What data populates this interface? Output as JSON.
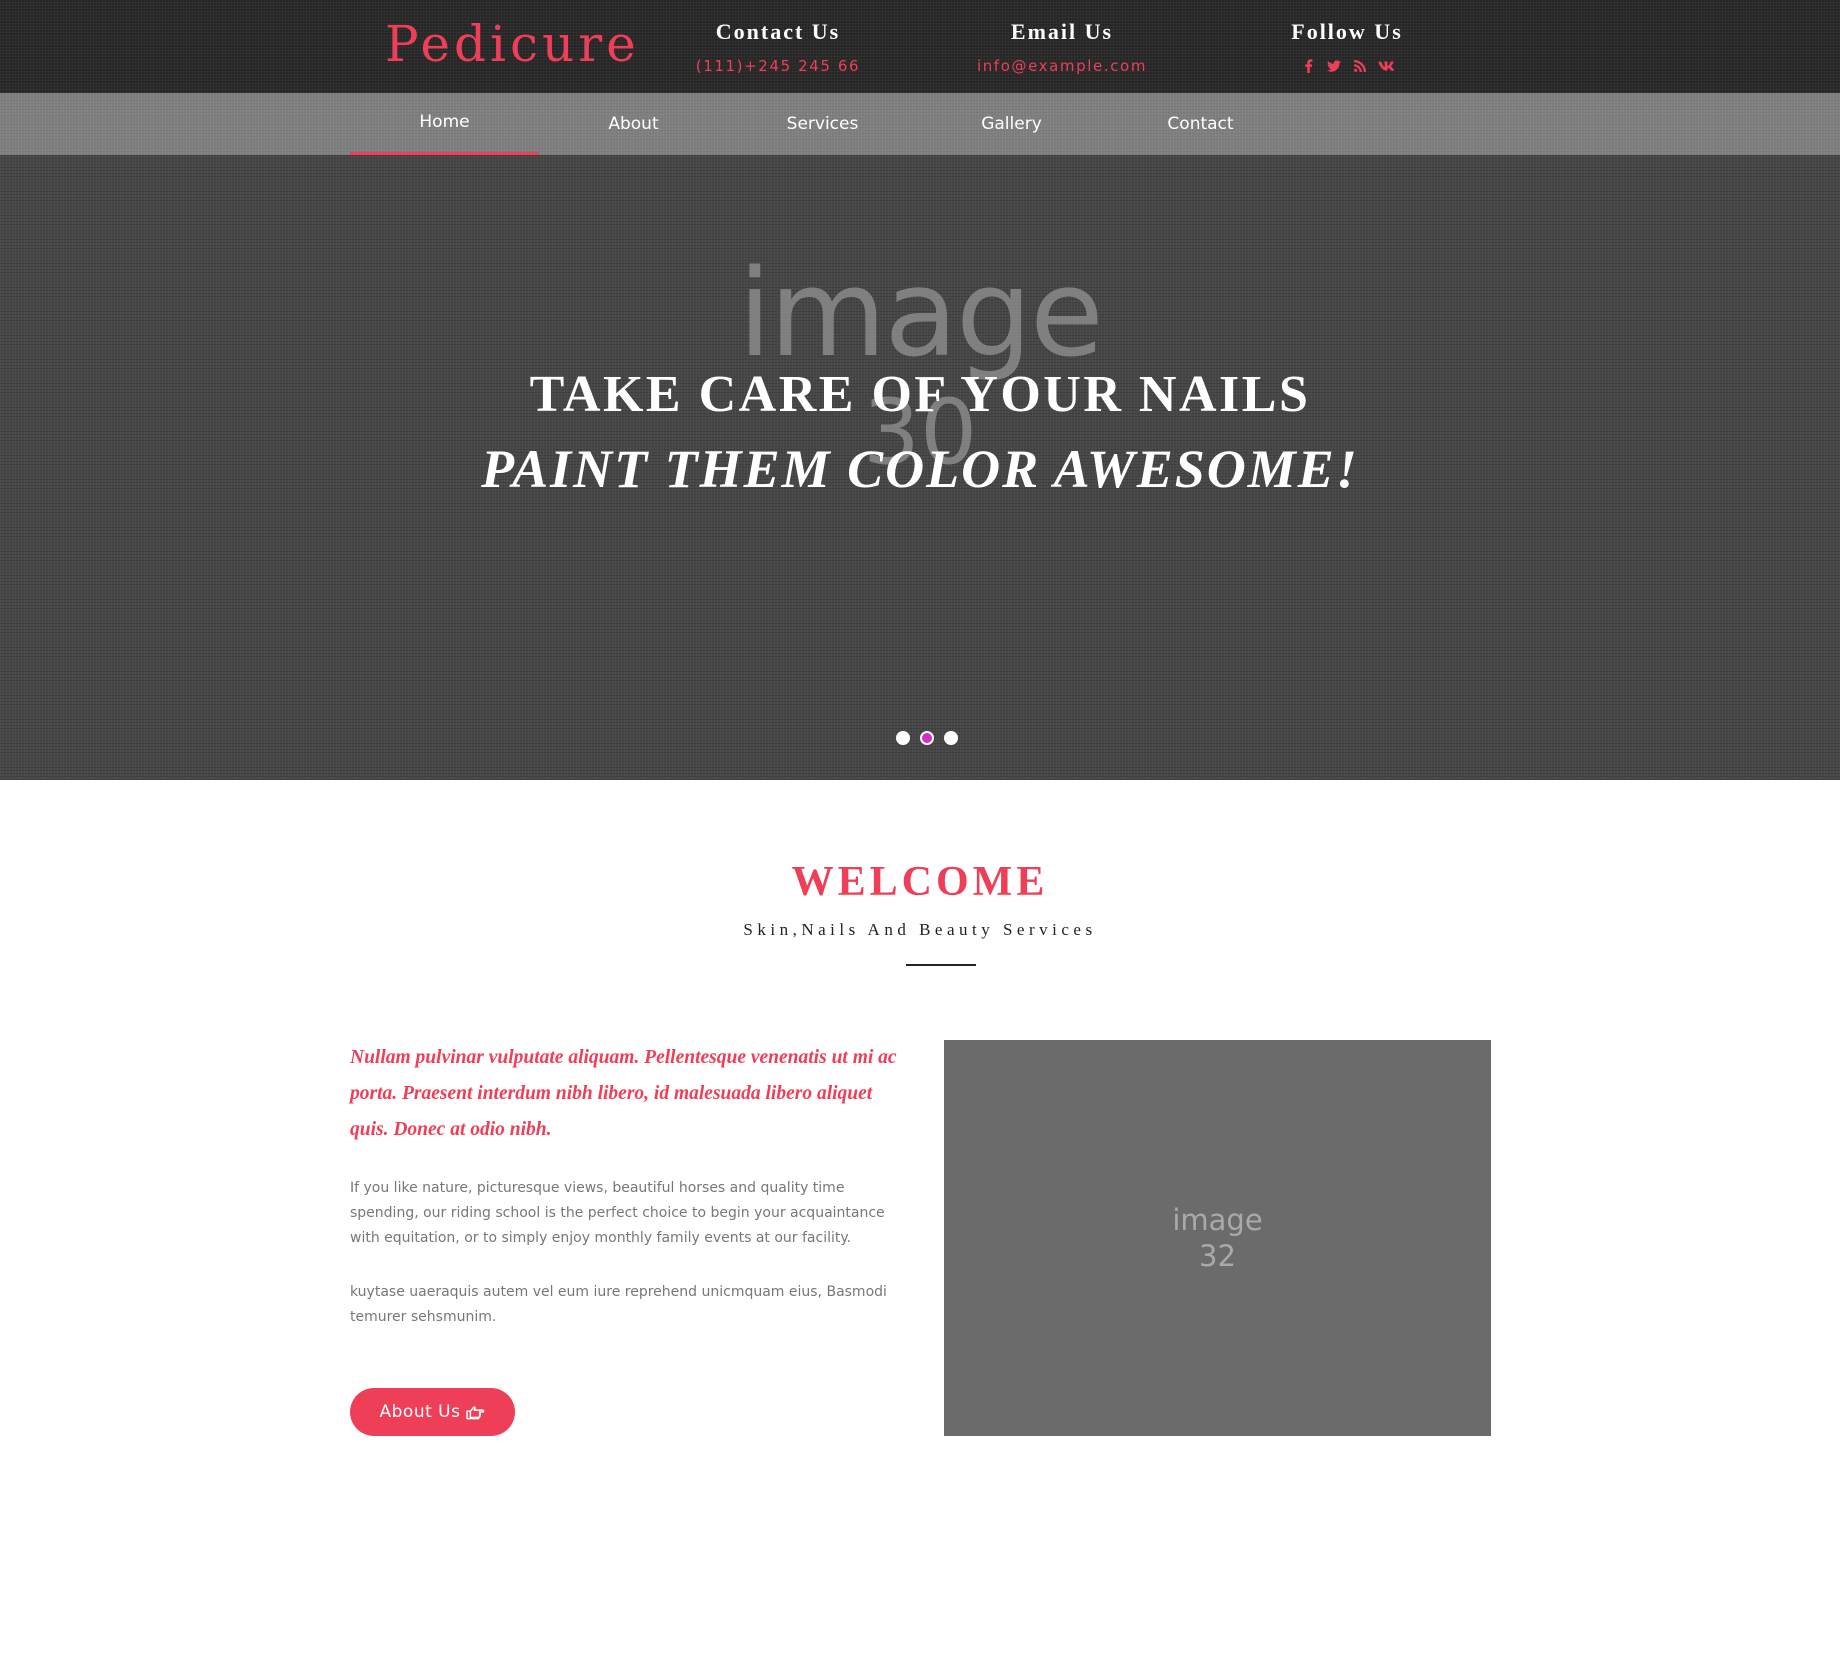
{
  "header": {
    "logo": "Pedicure",
    "contact": {
      "title": "Contact Us",
      "value": "(111)+245 245 66"
    },
    "email": {
      "title": "Email Us",
      "value": "info@example.com"
    },
    "follow": {
      "title": "Follow Us",
      "icons": [
        "facebook-icon",
        "twitter-icon",
        "rss-icon",
        "vk-icon"
      ]
    }
  },
  "nav": {
    "items": [
      {
        "label": "Home",
        "active": true
      },
      {
        "label": "About"
      },
      {
        "label": "Services"
      },
      {
        "label": "Gallery"
      },
      {
        "label": "Contact"
      }
    ]
  },
  "hero": {
    "placeholder_word": "image",
    "placeholder_number": "30",
    "line1": "TAKE CARE OF YOUR NAILS",
    "line2": "PAINT THEM COLOR AWESOME!",
    "slides": 3,
    "active_slide": 2
  },
  "welcome": {
    "title": "WELCOME",
    "subtitle": "Skin,Nails And Beauty Services",
    "lead": "Nullam pulvinar vulputate aliquam. Pellentesque venenatis ut mi ac porta. Praesent interdum nibh libero, id malesuada libero aliquet quis. Donec at odio nibh.",
    "paragraph1": "If you like nature, picturesque views, beautiful horses and quality time spending, our riding school is the perfect choice to begin your acquaintance with equitation, or to simply enjoy monthly family events at our facility.",
    "paragraph2": "kuytase uaeraquis autem vel eum iure reprehend unicmquam eius, Basmodi temurer sehsmunim.",
    "button_label": "About Us",
    "button_icon": "hand-pointing-right-icon",
    "image_placeholder_word": "image",
    "image_placeholder_number": "32"
  },
  "colors": {
    "accent": "#ef3e57",
    "topbar": "#262626",
    "navbar": "#7f7f7f",
    "hero": "#474747",
    "active_dot": "#d32ec6",
    "image_placeholder": "#6b6b6b"
  }
}
